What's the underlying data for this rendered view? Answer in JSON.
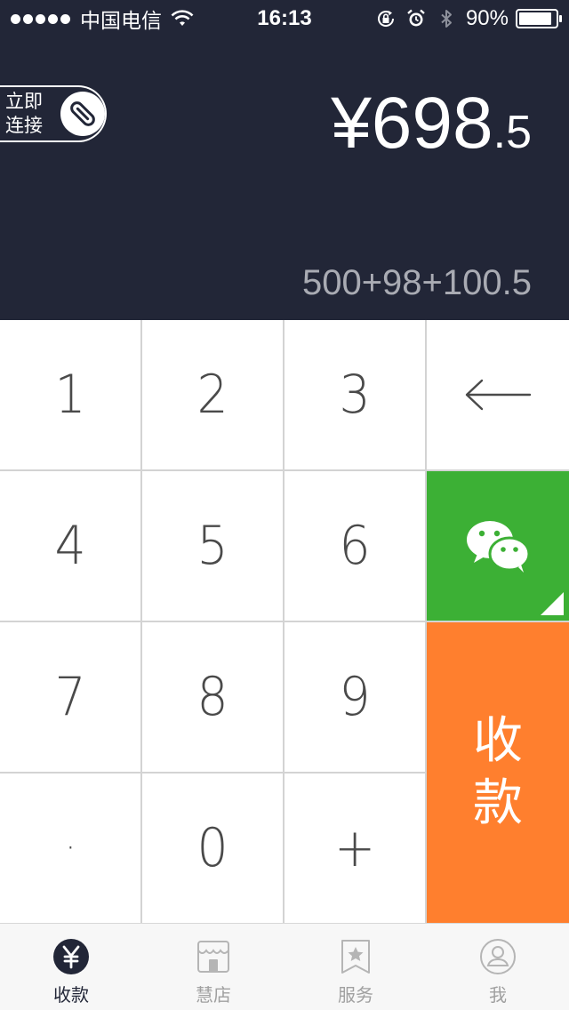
{
  "status_bar": {
    "signal_dots": 5,
    "carrier": "中国电信",
    "time": "16:13",
    "battery_percent": "90%",
    "battery_level": 0.9
  },
  "header": {
    "connect_label_line1": "立即",
    "connect_label_line2": "连接",
    "currency_symbol": "¥",
    "amount_integer": "698",
    "amount_decimal": ".5",
    "expression": "500+98+100.5"
  },
  "keypad": {
    "key_1": "1",
    "key_2": "2",
    "key_3": "3",
    "key_4": "4",
    "key_5": "5",
    "key_6": "6",
    "key_7": "7",
    "key_8": "8",
    "key_9": "9",
    "key_dot": "·",
    "key_0": "0",
    "key_plus": "+",
    "collect_line1": "收",
    "collect_line2": "款"
  },
  "colors": {
    "header_bg": "#222637",
    "wechat_green": "#3cb035",
    "collect_orange": "#ff7f2e"
  },
  "icons": {
    "backspace": "left-arrow-icon",
    "wechat": "wechat-icon",
    "connect": "link-icon"
  },
  "tabbar": {
    "tabs": [
      {
        "label": "收款",
        "icon": "yuan-icon",
        "active": true
      },
      {
        "label": "慧店",
        "icon": "store-icon",
        "active": false
      },
      {
        "label": "服务",
        "icon": "star-bookmark-icon",
        "active": false
      },
      {
        "label": "我",
        "icon": "user-icon",
        "active": false
      }
    ]
  }
}
